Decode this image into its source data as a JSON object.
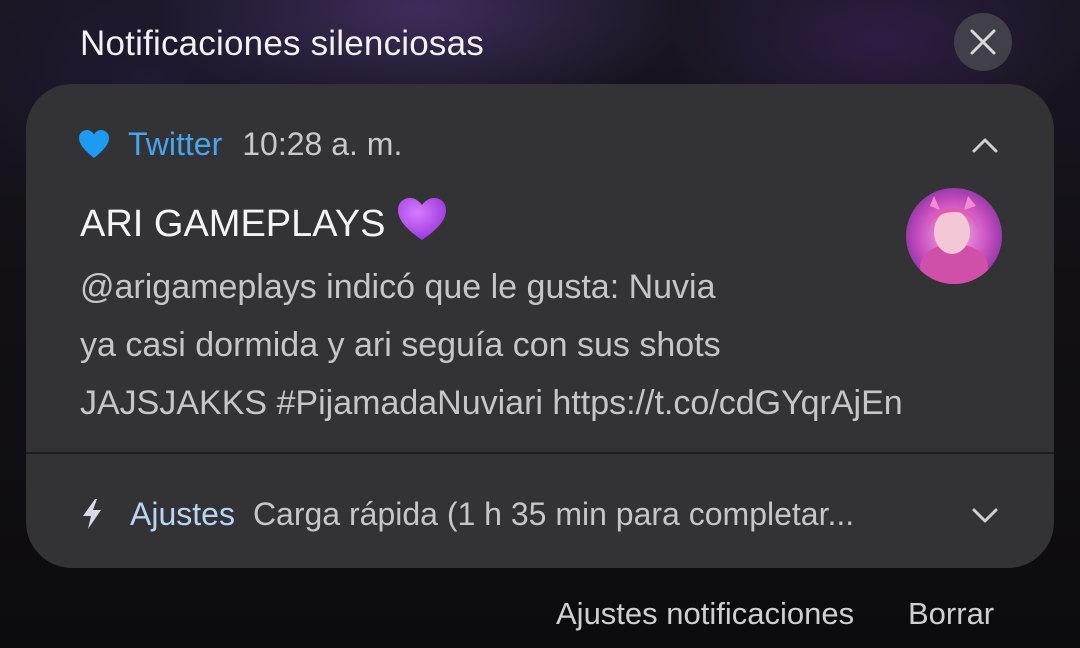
{
  "header": {
    "title": "Notificaciones silenciosas",
    "close_icon": "close-icon"
  },
  "notification": {
    "app_name": "Twitter",
    "app_icon": "heart-icon",
    "app_color": "#45a6f0",
    "time": "10:28 a. m.",
    "title": "ARI GAMEPLAYS",
    "title_emoji": "purple-heart-emoji",
    "body_lines": [
      "@arigameplays indicó que le gusta: Nuvia",
      "ya casi dormida y ari seguía con sus shots",
      "JAJSJAKKS #PijamadaNuviari https://t.co/cdGYqrAjEn"
    ],
    "avatar_icon": "avatar"
  },
  "settings_notification": {
    "app_name": "Ajustes",
    "app_icon": "bolt-icon",
    "text": "Carga rápida (1 h 35 min para completar..."
  },
  "footer": {
    "settings_label": "Ajustes notificaciones",
    "clear_label": "Borrar"
  }
}
